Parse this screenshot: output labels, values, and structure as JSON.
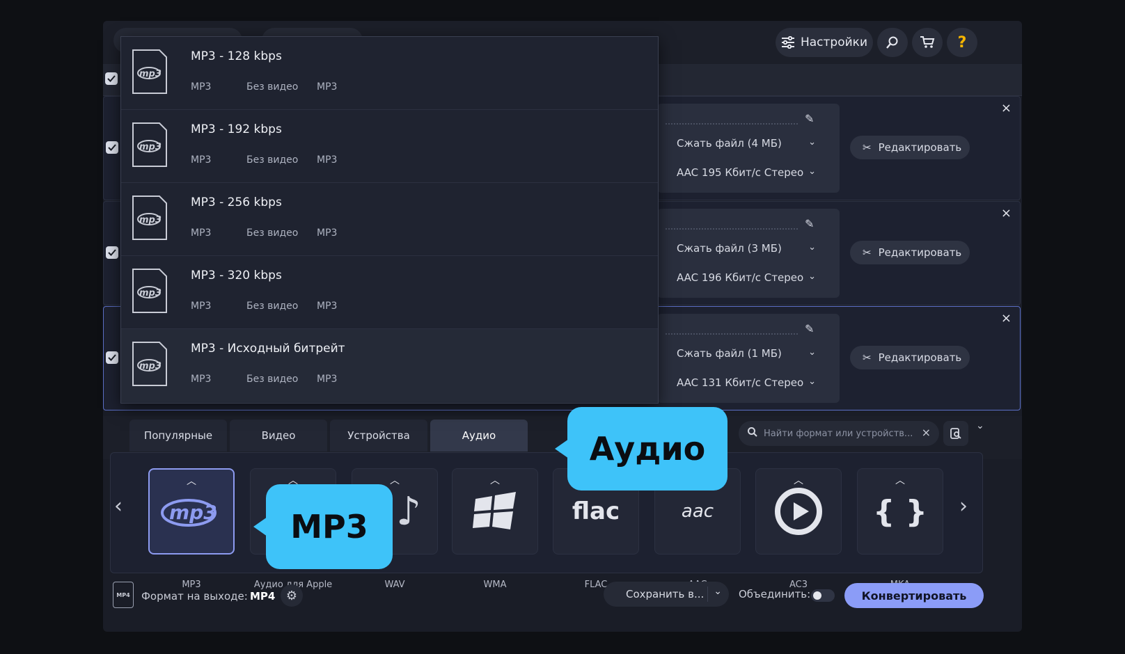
{
  "topbar": {
    "settings_label": "Настройки",
    "search_icon": "search-icon",
    "cart_icon": "cart-icon",
    "help_icon": "help-icon"
  },
  "files": [
    {
      "compress": "Сжать файл (4 МБ)",
      "audio": "AAC 195 Кбит/с Стерео",
      "edit": "Редактировать"
    },
    {
      "compress": "Сжать файл (3 МБ)",
      "audio": "AAC 196 Кбит/с Стерео",
      "edit": "Редактировать"
    },
    {
      "compress": "Сжать файл (1 МБ)",
      "audio": "AAC 131 Кбит/с Стерео",
      "edit": "Редактировать"
    }
  ],
  "dropdown": [
    {
      "title": "MP3 - 128 kbps",
      "m1": "MP3",
      "m2": "Без видео",
      "m3": "MP3"
    },
    {
      "title": "MP3 - 192 kbps",
      "m1": "MP3",
      "m2": "Без видео",
      "m3": "MP3"
    },
    {
      "title": "MP3 - 256 kbps",
      "m1": "MP3",
      "m2": "Без видео",
      "m3": "MP3"
    },
    {
      "title": "MP3 - 320 kbps",
      "m1": "MP3",
      "m2": "Без видео",
      "m3": "MP3"
    },
    {
      "title": "MP3 - Исходный битрейт",
      "m1": "MP3",
      "m2": "Без видео",
      "m3": "MP3"
    }
  ],
  "tabs": [
    "Популярные",
    "Видео",
    "Устройства",
    "Аудио"
  ],
  "search_placeholder": "Найти формат или устройств...",
  "formats": [
    {
      "label": "MP3",
      "icon": "mp3-icon"
    },
    {
      "label": "Аудио для Apple",
      "icon": "apple-icon"
    },
    {
      "label": "WAV",
      "icon": "music-note-icon"
    },
    {
      "label": "WMA",
      "icon": "windows-icon"
    },
    {
      "label": "FLAC",
      "icon": "flac-icon"
    },
    {
      "label": "AAC",
      "icon": "aac-icon"
    },
    {
      "label": "AC3",
      "icon": "play-icon"
    },
    {
      "label": "MKA",
      "icon": "braces-icon"
    }
  ],
  "bottom": {
    "output_label": "Формат на выходе:",
    "output_value": "MP4",
    "save_label": "Сохранить в...",
    "merge_label": "Объединить:",
    "convert_label": "Конвертировать"
  },
  "callouts": {
    "audio": "Аудио",
    "mp3": "MP3"
  },
  "colors": {
    "accent": "#8b9cf7",
    "callout": "#3ec3f9",
    "background": "#1a1d27"
  }
}
